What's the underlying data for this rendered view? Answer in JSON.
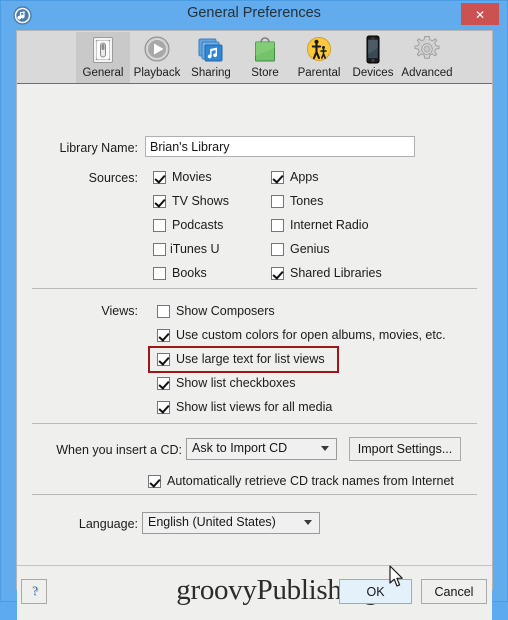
{
  "window": {
    "title": "General Preferences",
    "app_icon": "itunes-note-icon",
    "close_label": "✕",
    "titlebar_color": "#62abec",
    "close_color": "#cc5252"
  },
  "toolbar": {
    "selected": "General",
    "items": [
      {
        "label": "General",
        "icon": "toggle-switch-icon"
      },
      {
        "label": "Playback",
        "icon": "play-circle-icon"
      },
      {
        "label": "Sharing",
        "icon": "stacked-music-icon"
      },
      {
        "label": "Store",
        "icon": "shopping-bag-icon"
      },
      {
        "label": "Parental",
        "icon": "parental-controls-icon"
      },
      {
        "label": "Devices",
        "icon": "iphone-icon"
      },
      {
        "label": "Advanced",
        "icon": "gear-icon"
      }
    ]
  },
  "library": {
    "label": "Library Name:",
    "value": "Brian's Library",
    "placeholder": ""
  },
  "sources": {
    "label": "Sources:",
    "column_left": [
      {
        "label": "Movies",
        "checked": true
      },
      {
        "label": "TV Shows",
        "checked": true
      },
      {
        "label": "Podcasts",
        "checked": false
      },
      {
        "label": "iTunes U",
        "checked": false
      },
      {
        "label": "Books",
        "checked": false
      }
    ],
    "column_right": [
      {
        "label": "Apps",
        "checked": true
      },
      {
        "label": "Tones",
        "checked": false
      },
      {
        "label": "Internet Radio",
        "checked": false
      },
      {
        "label": "Genius",
        "checked": false
      },
      {
        "label": "Shared Libraries",
        "checked": true
      }
    ]
  },
  "views": {
    "label": "Views:",
    "items": [
      {
        "label": "Show Composers",
        "checked": false,
        "highlighted": false
      },
      {
        "label": "Use custom colors for open albums, movies, etc.",
        "checked": true,
        "highlighted": false
      },
      {
        "label": "Use large text for list views",
        "checked": true,
        "highlighted": true
      },
      {
        "label": "Show list checkboxes",
        "checked": true,
        "highlighted": false
      },
      {
        "label": "Show list views for all media",
        "checked": true,
        "highlighted": false
      }
    ],
    "highlight_color": "#9e1616"
  },
  "cd": {
    "label": "When you insert a CD:",
    "selected": "Ask to Import CD",
    "import_settings_label": "Import Settings...",
    "auto_retrieve": {
      "label": "Automatically retrieve CD track names from Internet",
      "checked": true
    }
  },
  "language": {
    "label": "Language:",
    "selected": "English (United States)"
  },
  "footer": {
    "help_label": "?",
    "watermark": "groovyPublishing",
    "ok_label": "OK",
    "cancel_label": "Cancel",
    "ok_hovered": true
  }
}
